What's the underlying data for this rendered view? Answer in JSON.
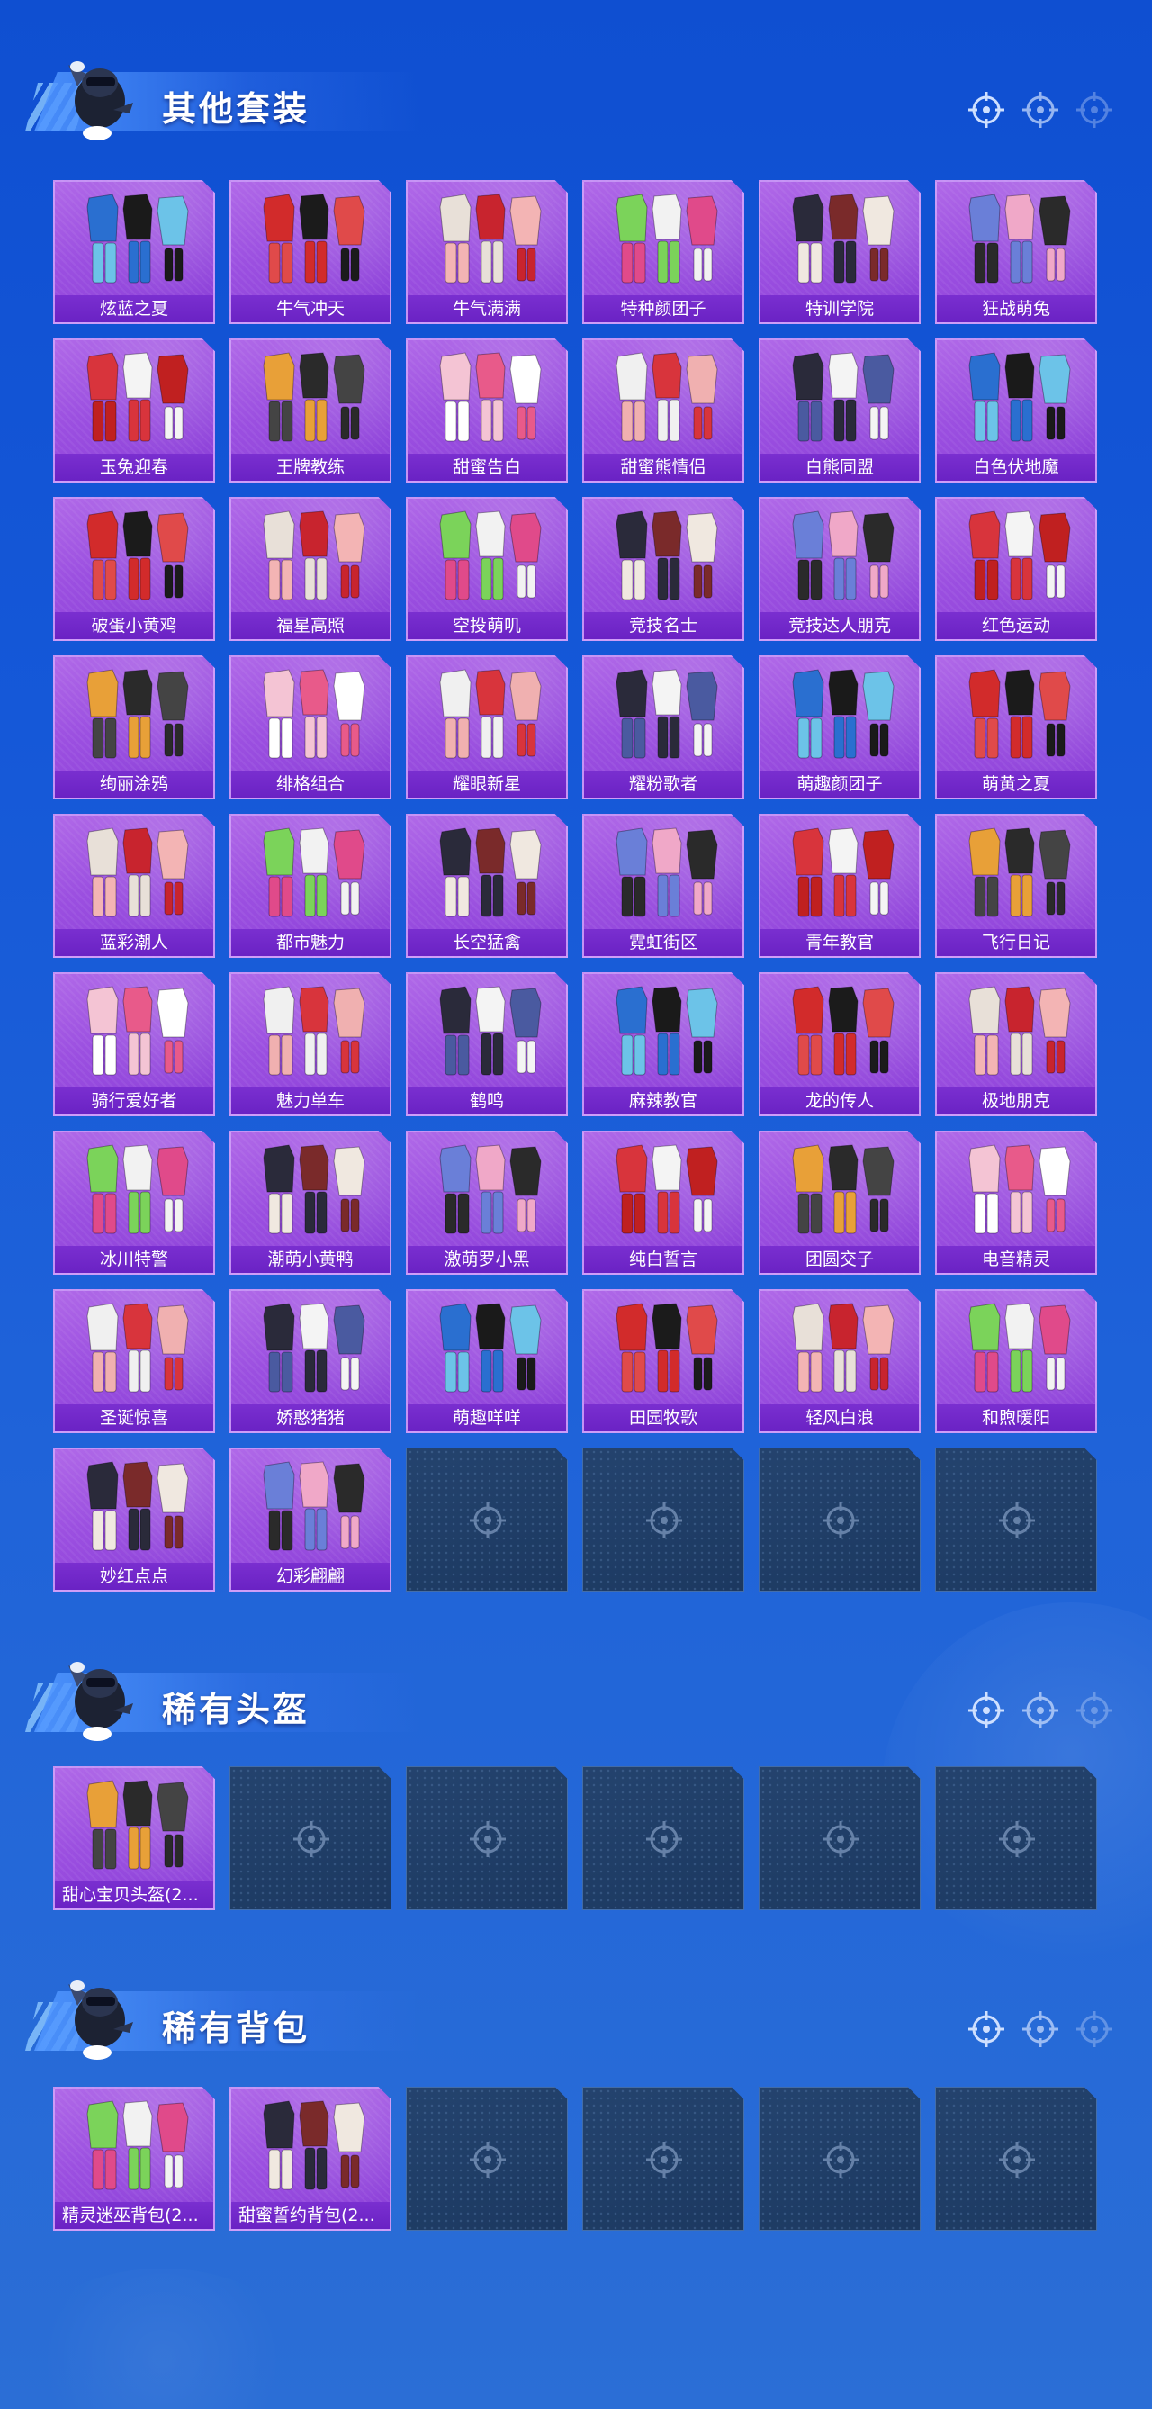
{
  "sections": [
    {
      "title": "其他套装",
      "items": [
        "炫蓝之夏",
        "牛气冲天",
        "牛气满满",
        "特种颜团子",
        "特训学院",
        "狂战萌兔",
        "玉兔迎春",
        "王牌教练",
        "甜蜜告白",
        "甜蜜熊情侣",
        "白熊同盟",
        "白色伏地魔",
        "破蛋小黄鸡",
        "福星高照",
        "空投萌叽",
        "竞技名士",
        "竞技达人朋克",
        "红色运动",
        "绚丽涂鸦",
        "绯格组合",
        "耀眼新星",
        "耀粉歌者",
        "萌趣颜团子",
        "萌黄之夏",
        "蓝彩潮人",
        "都市魅力",
        "长空猛禽",
        "霓虹街区",
        "青年教官",
        "飞行日记",
        "骑行爱好者",
        "魅力单车",
        "鹤鸣",
        "麻辣教官",
        "龙的传人",
        "极地朋克",
        "冰川特警",
        "潮萌小黄鸭",
        "激萌罗小黑",
        "纯白誓言",
        "团圆交子",
        "电音精灵",
        "圣诞惊喜",
        "娇憨猪猪",
        "萌趣咩咩",
        "田园牧歌",
        "轻风白浪",
        "和煦暖阳",
        "妙红点点",
        "幻彩翩翩"
      ]
    },
    {
      "title": "稀有头盔",
      "items": [
        "甜心宝贝头盔(2..."
      ]
    },
    {
      "title": "稀有背包",
      "items": [
        "精灵迷巫背包(2...",
        "甜蜜誓约背包(2..."
      ]
    }
  ],
  "icons": {
    "header_mascot": "mascot-icon",
    "header_target": "crosshair-icon",
    "empty_slot": "crosshair-icon"
  },
  "colors": {
    "card_purple": "#9b4fe0",
    "label_purple": "#6a22c4",
    "empty_slot": "#1f3d66",
    "background": "#1558d8"
  }
}
